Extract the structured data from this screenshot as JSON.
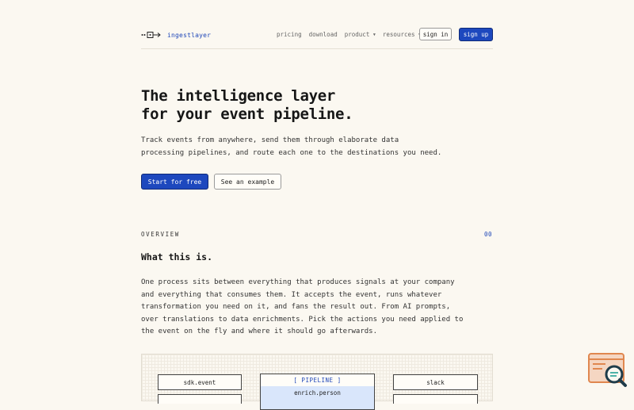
{
  "nav": {
    "brand": "ingestlayer",
    "links": [
      "pricing",
      "download",
      "product",
      "resources"
    ],
    "signin": "sign in",
    "signup": "sign up"
  },
  "hero": {
    "title_line1": "The intelligence layer",
    "title_line2": "for your event pipeline.",
    "subtitle_line1": "Track events from anywhere, send them through elaborate data",
    "subtitle_line2": "processing pipelines, and route each one to the destinations you need.",
    "cta_primary": "Start for free",
    "cta_secondary": "See an example"
  },
  "overview": {
    "label": "OVERVIEW",
    "number": "00",
    "heading": "What this is.",
    "para_lines": [
      "One process sits between everything that produces signals at your company",
      "and everything that consumes them. It accepts the event, runs whatever",
      "transformation you need on it, and fans the result out. From AI prompts,",
      "over translations to data enrichments. Pick the actions you need applied to",
      "the event on the fly and where it should go afterwards."
    ]
  },
  "diagram": {
    "source": "sdk.event",
    "pipeline_header": "[ PIPELINE ]",
    "pipeline_step": "enrich.person",
    "destination": "slack"
  }
}
